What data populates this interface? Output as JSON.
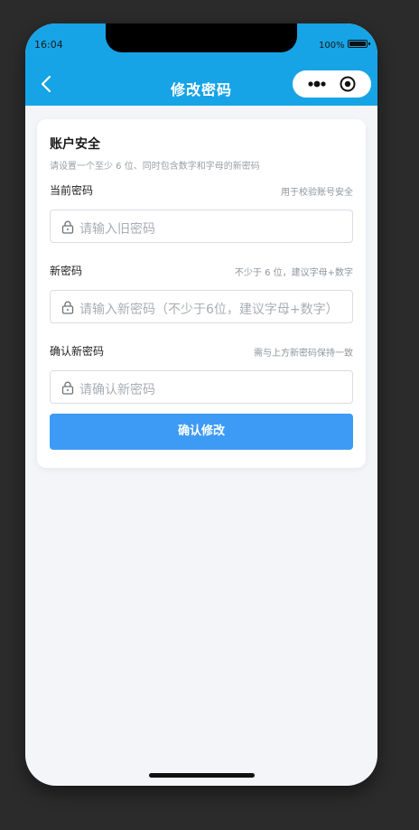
{
  "status_bar": {
    "time": "16:04",
    "battery": "100%"
  },
  "nav": {
    "title": "修改密码"
  },
  "card": {
    "title": "账户安全",
    "subtitle": "请设置一个至少 6 位、同时包含数字和字母的新密码"
  },
  "fields": [
    {
      "label": "当前密码",
      "hint": "用于校验账号安全",
      "placeholder": "请输入旧密码"
    },
    {
      "label": "新密码",
      "hint": "不少于 6 位，建议字母+数字",
      "placeholder": "请输入新密码（不少于6位，建议字母+数字）"
    },
    {
      "label": "确认新密码",
      "hint": "需与上方新密码保持一致",
      "placeholder": "请确认新密码"
    }
  ],
  "submit_label": "确认修改",
  "colors": {
    "nav_bg": "#17a4e6",
    "button_bg": "#3d9bf5",
    "page_bg": "#f3f5f9"
  },
  "icons": [
    "back-chevron-icon",
    "more-dots-icon",
    "target-circle-icon",
    "lock-icon"
  ]
}
